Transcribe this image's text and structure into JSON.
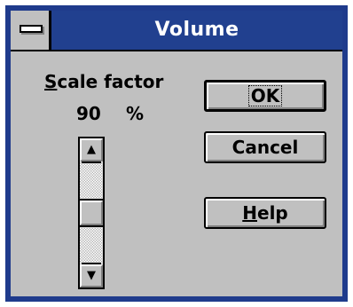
{
  "window": {
    "title": "Volume",
    "system_menu_icon": "system-menu-icon"
  },
  "scale": {
    "label_mnemonic": "S",
    "label_rest": "cale factor",
    "value": "90",
    "unit": "%"
  },
  "scrollbar": {
    "up_icon": "▲",
    "down_icon": "▼",
    "thumb_fraction": 0.5
  },
  "buttons": {
    "ok_label": "OK",
    "cancel_label": "Cancel",
    "help_mnemonic": "H",
    "help_rest": "elp"
  },
  "colors": {
    "titlebar": "#21408f",
    "frame": "#1f3b8c",
    "face": "#c0c0c0"
  }
}
